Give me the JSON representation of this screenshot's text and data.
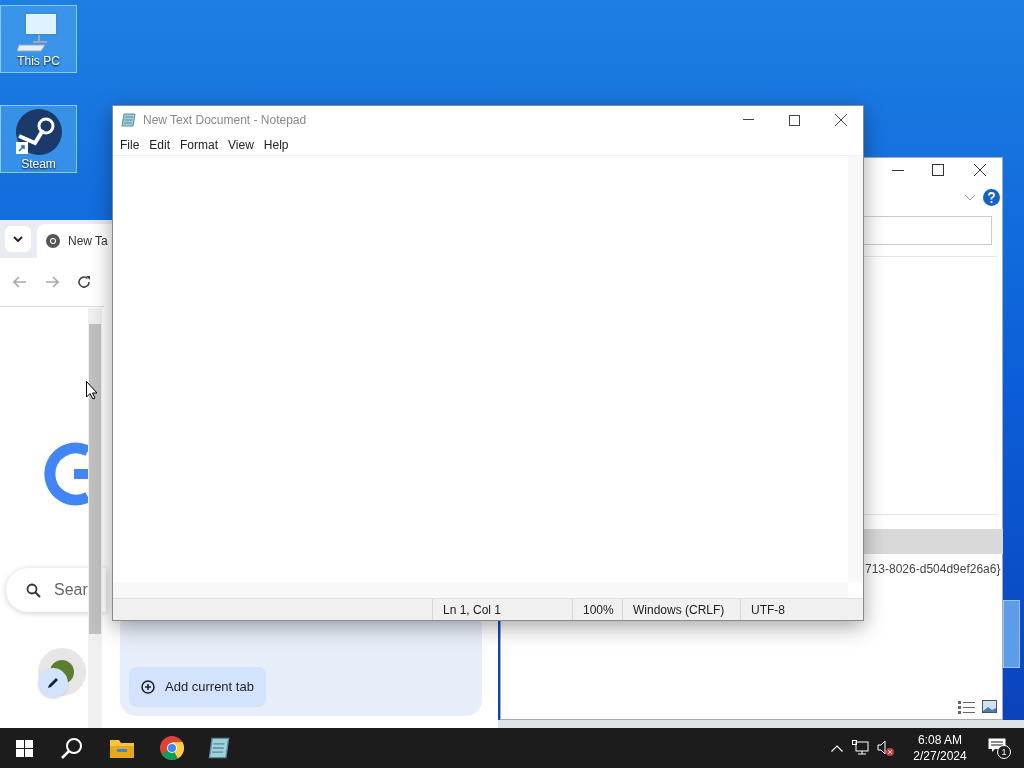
{
  "desktop_icons": [
    {
      "label": "This PC",
      "kind": "pc",
      "selected": true
    },
    {
      "label": "Steam",
      "kind": "steam",
      "selected": true
    }
  ],
  "chrome": {
    "tab_title": "New Ta",
    "search_placeholder": "Sear",
    "side_panel_button": "Add current tab"
  },
  "explorer": {
    "guid_text": "713-8026-d504d9ef26a6}"
  },
  "notepad": {
    "title": "New Text Document - Notepad",
    "menu": [
      "File",
      "Edit",
      "Format",
      "View",
      "Help"
    ],
    "status_bar": [
      "Ln 1, Col 1",
      "100%",
      "Windows (CRLF)",
      "UTF-8"
    ]
  },
  "taskbar": {
    "time": "6:08 AM",
    "date": "2/27/2024",
    "notification_count": "1",
    "volume_muted": true
  }
}
